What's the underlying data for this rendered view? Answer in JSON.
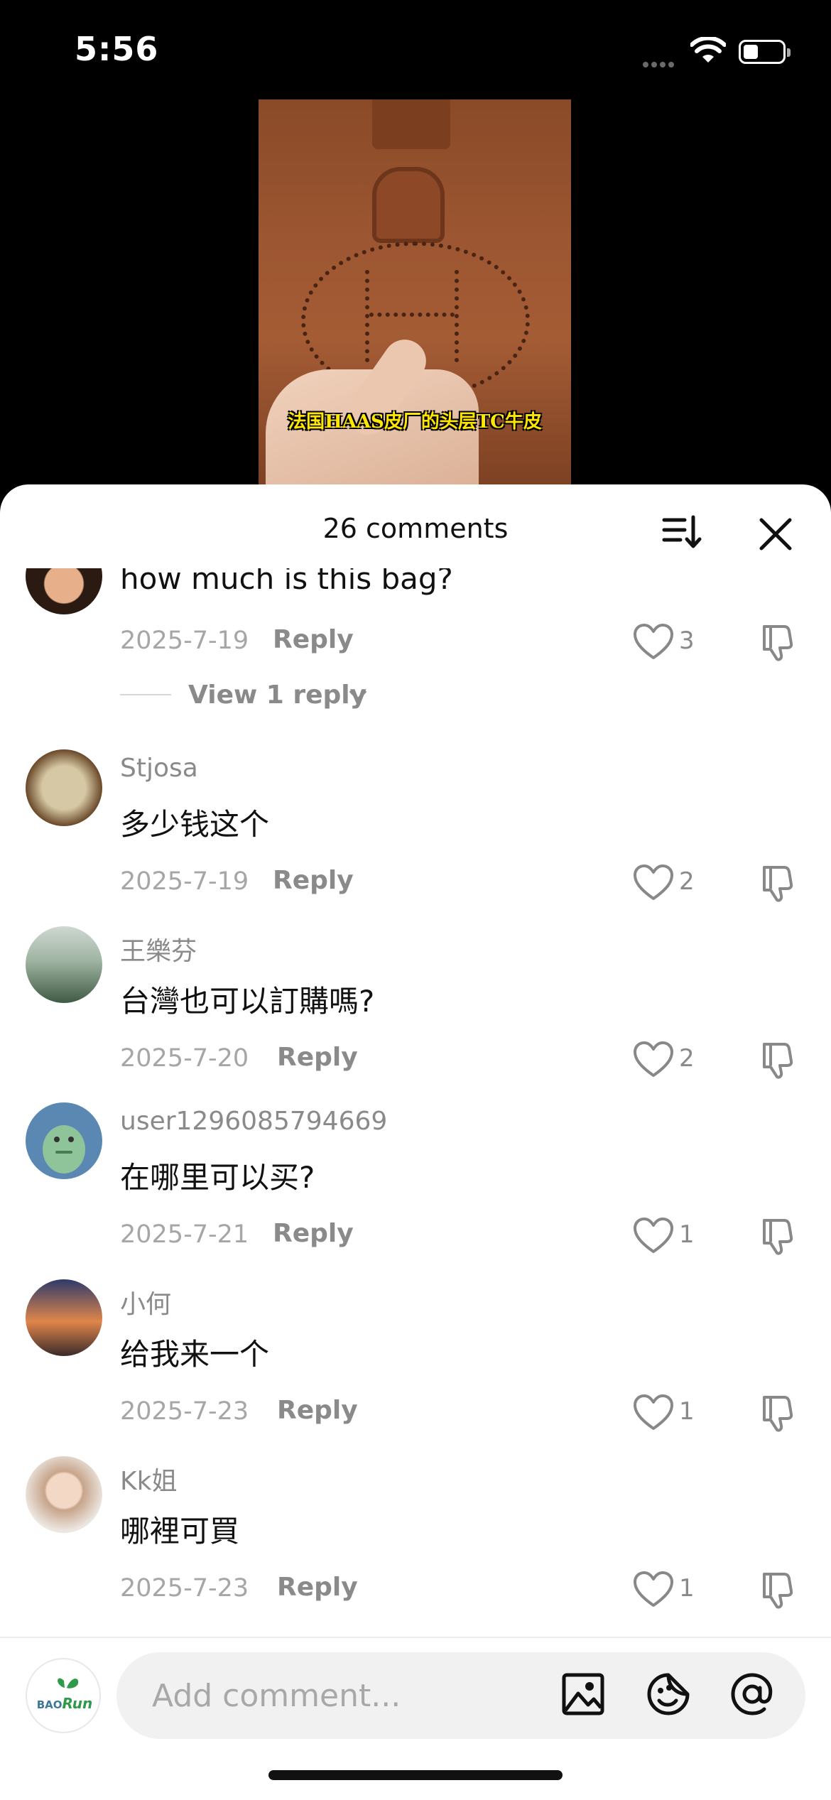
{
  "status_bar": {
    "time": "5:56"
  },
  "video": {
    "caption": "法国HAAS皮厂的头层TC牛皮"
  },
  "header": {
    "title": "26 comments",
    "sort_icon": "sort-icon",
    "close_icon": "close-icon"
  },
  "comments": [
    {
      "username": "",
      "text": "how much is this bag?",
      "date": "2025-7-19",
      "reply_label": "Reply",
      "likes": "3",
      "view_replies": "View 1 reply"
    },
    {
      "username": "Stjosa",
      "text": "多少钱这个",
      "date": "2025-7-19",
      "reply_label": "Reply",
      "likes": "2"
    },
    {
      "username": "王樂芬",
      "text": "台灣也可以訂購嗎?",
      "date": "2025-7-20",
      "reply_label": "Reply",
      "likes": "2"
    },
    {
      "username": "user1296085794669",
      "text": "在哪里可以买?",
      "date": "2025-7-21",
      "reply_label": "Reply",
      "likes": "1"
    },
    {
      "username": "小何",
      "text": "给我来一个",
      "date": "2025-7-23",
      "reply_label": "Reply",
      "likes": "1"
    },
    {
      "username": "Kk姐",
      "text": "哪裡可買",
      "date": "2025-7-23",
      "reply_label": "Reply",
      "likes": "1"
    }
  ],
  "composer": {
    "placeholder": "Add comment...",
    "avatar_text_1": "BAO",
    "avatar_text_2": "Run"
  },
  "colors": {
    "sheet": "#ffffff",
    "muted": "#8a8a8a",
    "date": "#a6a6a6",
    "input_bg": "#f1f1f1",
    "brand_green": "#2e9a4a"
  }
}
